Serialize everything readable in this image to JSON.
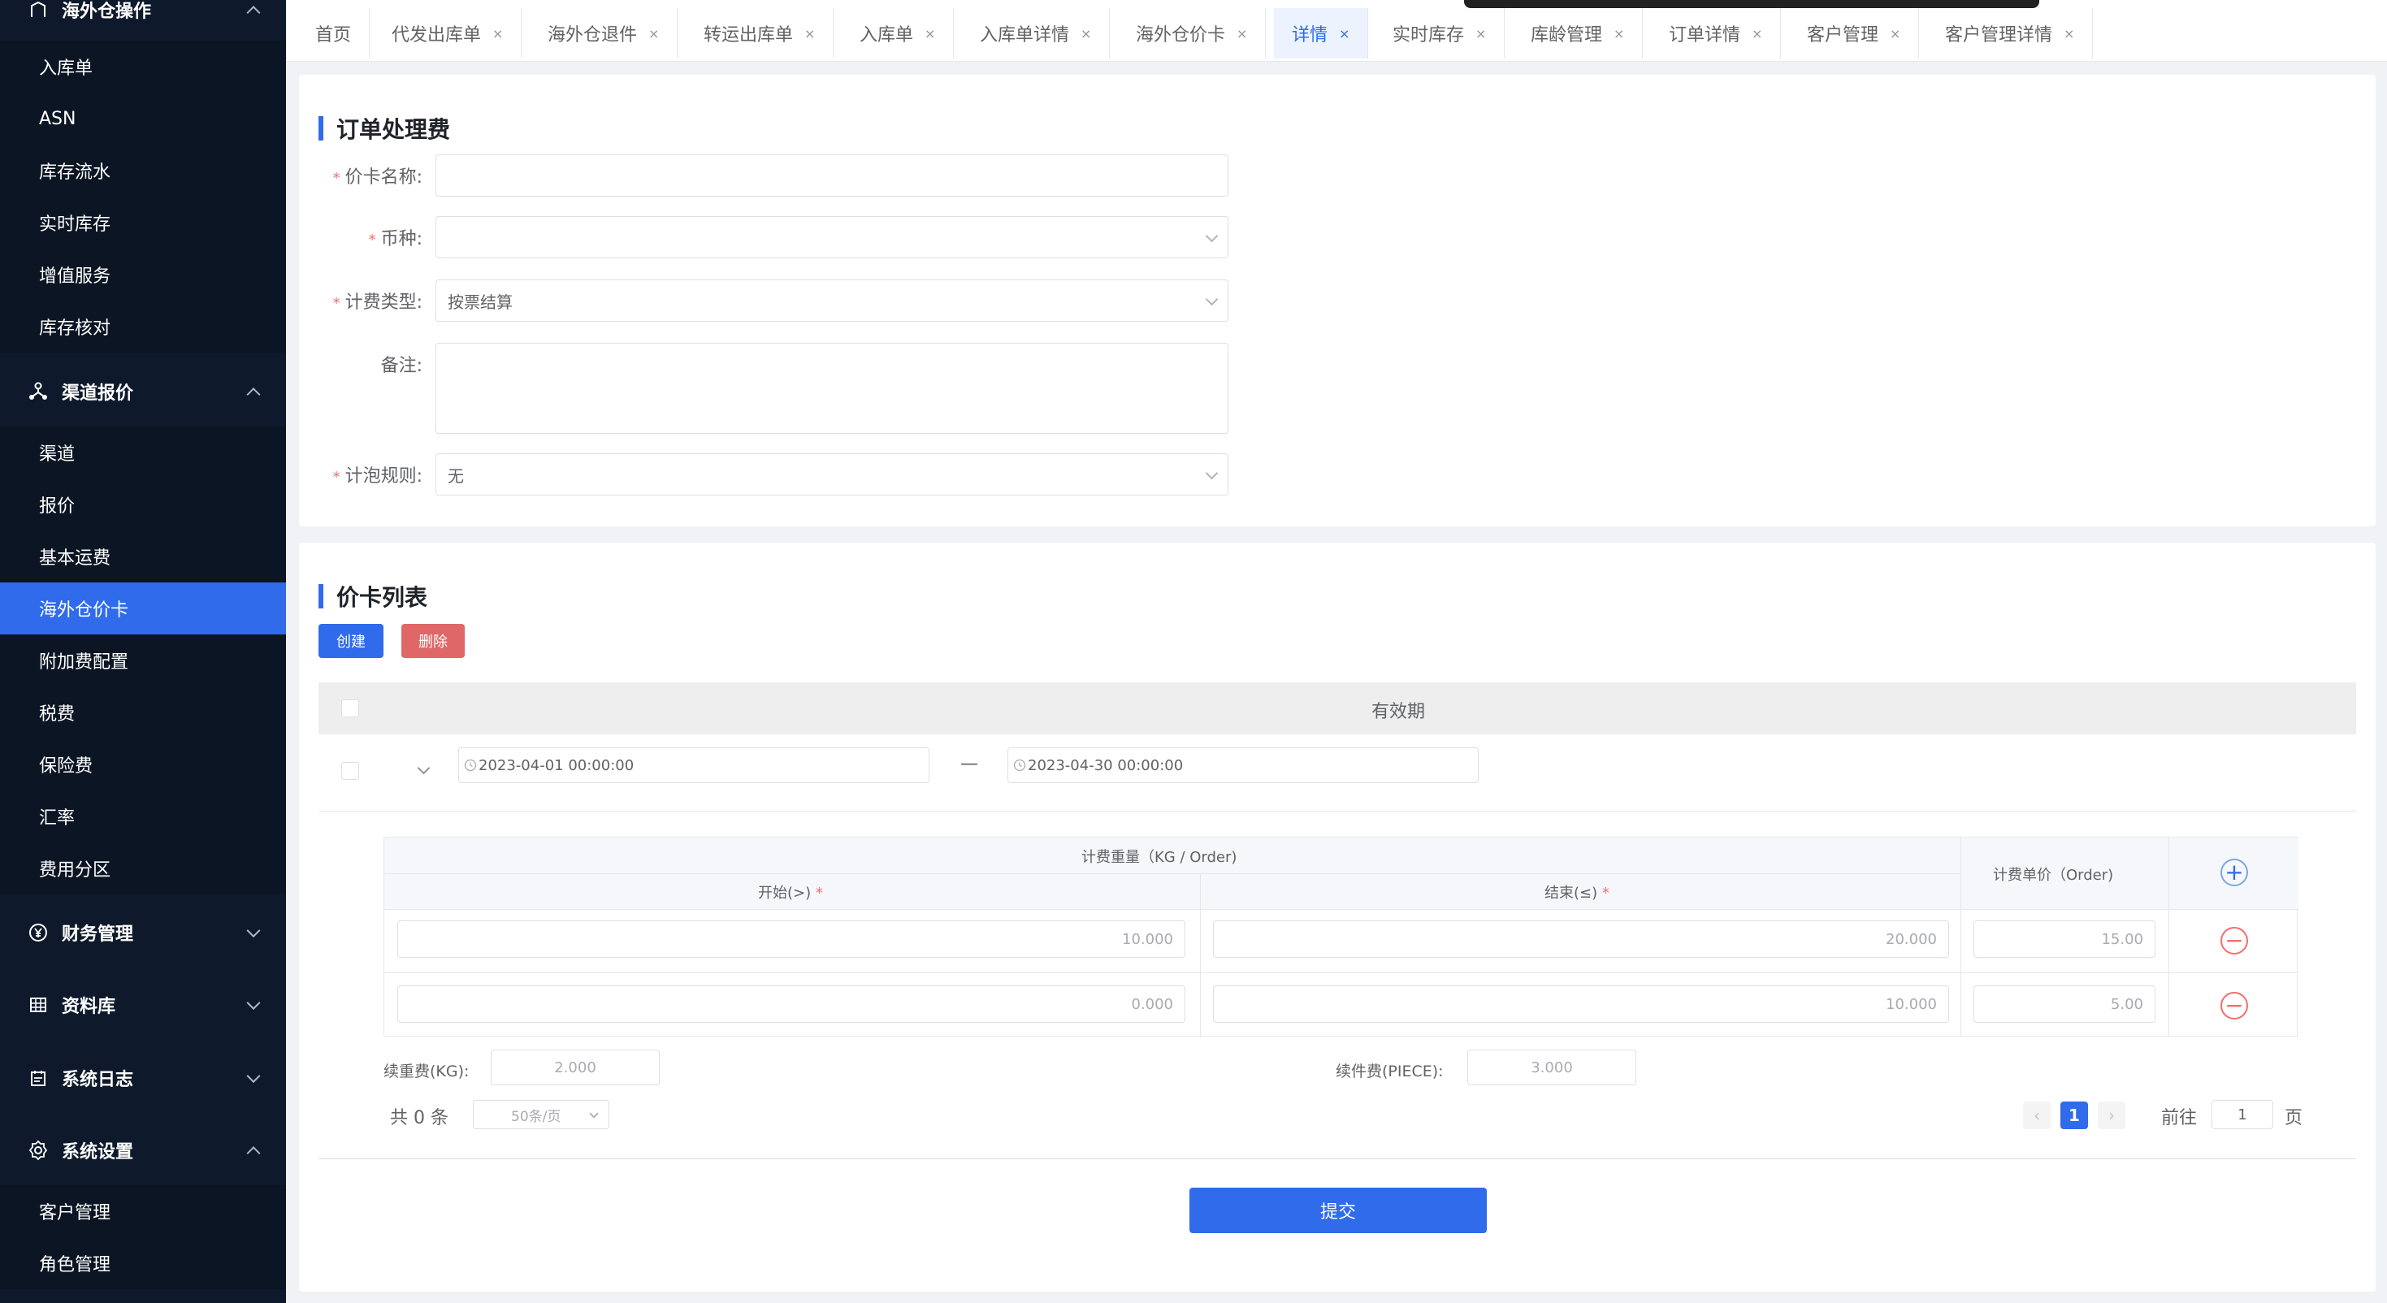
{
  "sidebar": {
    "top_group": "海外仓操作",
    "group1_items": [
      "入库单",
      "ASN",
      "库存流水",
      "实时库存",
      "增值服务",
      "库存核对"
    ],
    "channel_group": "渠道报价",
    "group2_items": [
      "渠道",
      "报价",
      "基本运费",
      "海外仓价卡",
      "附加费配置",
      "税费",
      "保险费",
      "汇率",
      "费用分区"
    ],
    "active_item": "海外仓价卡",
    "finance": "财务管理",
    "library": "资料库",
    "syslog": "系统日志",
    "settings": "系统设置",
    "group3_items": [
      "客户管理",
      "角色管理"
    ]
  },
  "tabs": [
    {
      "label": "首页",
      "closable": false
    },
    {
      "label": "代发出库单",
      "closable": true
    },
    {
      "label": "海外仓退件",
      "closable": true
    },
    {
      "label": "转运出库单",
      "closable": true
    },
    {
      "label": "入库单",
      "closable": true
    },
    {
      "label": "入库单详情",
      "closable": true
    },
    {
      "label": "海外仓价卡",
      "closable": true
    },
    {
      "label": "详情",
      "closable": true,
      "active": true
    },
    {
      "label": "实时库存",
      "closable": true
    },
    {
      "label": "库龄管理",
      "closable": true
    },
    {
      "label": "订单详情",
      "closable": true
    },
    {
      "label": "客户管理",
      "closable": true
    },
    {
      "label": "客户管理详情",
      "closable": true
    }
  ],
  "tab_close_glyph": "×",
  "form": {
    "title": "订单处理费",
    "price_name_label": "价卡名称:",
    "price_name_value": "",
    "currency_label": "币种:",
    "currency_value": "",
    "billing_type_label": "计费类型:",
    "billing_type_value": "按票结算",
    "remark_label": "备注:",
    "remark_value": "",
    "bubble_rule_label": "计泡规则:",
    "bubble_rule_value": "无",
    "required_mark": "*"
  },
  "list": {
    "title": "价卡列表",
    "create_btn": "创建",
    "delete_btn": "删除",
    "validity_header": "有效期",
    "date_start": "2023-04-01 00:00:00",
    "date_end": "2023-04-30 00:00:00",
    "date_separator": "—",
    "inner": {
      "weight_header": "计费重量（KG / Order)",
      "start_header": "开始(>)",
      "end_header": "结束(≤)",
      "unit_price_header": "计费单价（Order)",
      "rows": [
        {
          "start": "10.000",
          "end": "20.000",
          "price": "15.00"
        },
        {
          "start": "0.000",
          "end": "10.000",
          "price": "5.00"
        }
      ]
    },
    "continue_weight_label": "续重费(KG):",
    "continue_weight_value": "2.000",
    "continue_piece_label": "续件费(PIECE):",
    "continue_piece_value": "3.000",
    "total_text": "共 0 条",
    "page_size": "50条/页",
    "current_page": "1",
    "goto_label": "前往",
    "goto_value": "1",
    "page_suffix": "页"
  },
  "submit_btn": "提交"
}
